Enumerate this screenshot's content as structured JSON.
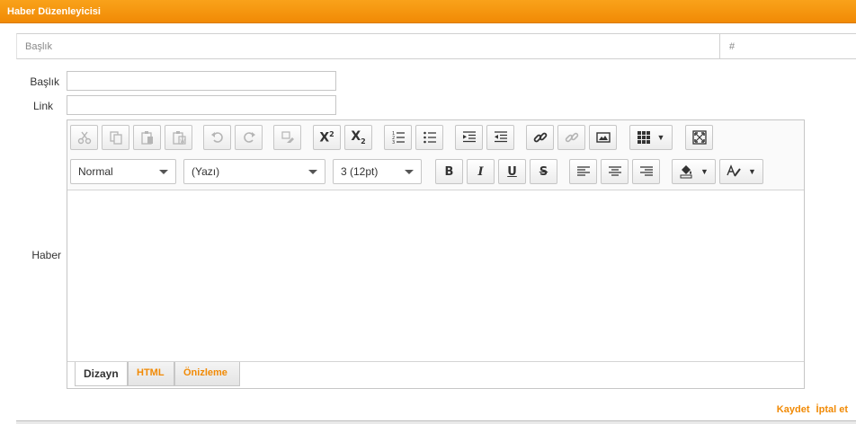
{
  "window": {
    "title": "Haber Düzenleyicisi"
  },
  "grid": {
    "col_title": "Başlık",
    "col_hash": "#"
  },
  "form": {
    "title_label": "Başlık",
    "title_value": "",
    "link_label": "Link",
    "link_value": "",
    "content_label": "Haber"
  },
  "toolbar": {
    "row1": [
      "cut-icon",
      "copy-icon",
      "paste-icon",
      "paste-word-icon",
      "undo-icon",
      "redo-icon",
      "clear-format-icon",
      "superscript-icon",
      "subscript-icon",
      "ordered-list-icon",
      "unordered-list-icon",
      "outdent-icon",
      "indent-icon",
      "link-icon",
      "unlink-icon",
      "image-icon",
      "table-icon",
      "fullscreen-icon"
    ],
    "format_select": "Normal",
    "font_select": "(Yazı)",
    "size_select": "3 (12pt)",
    "bold": "B",
    "italic": "I",
    "underline": "U",
    "strike": "S",
    "superscript_glyph": "X",
    "superscript_mark": "2",
    "subscript_glyph": "X",
    "subscript_mark": "2"
  },
  "tabs": [
    {
      "label": "Dizayn",
      "active": true
    },
    {
      "label": "HTML",
      "active": false
    },
    {
      "label": "Önizleme",
      "active": false
    }
  ],
  "footer": {
    "save_label": "Kaydet",
    "cancel_label": "İptal et"
  },
  "colors": {
    "accent": "#f18a05",
    "title_bg": "#f9a21a"
  }
}
